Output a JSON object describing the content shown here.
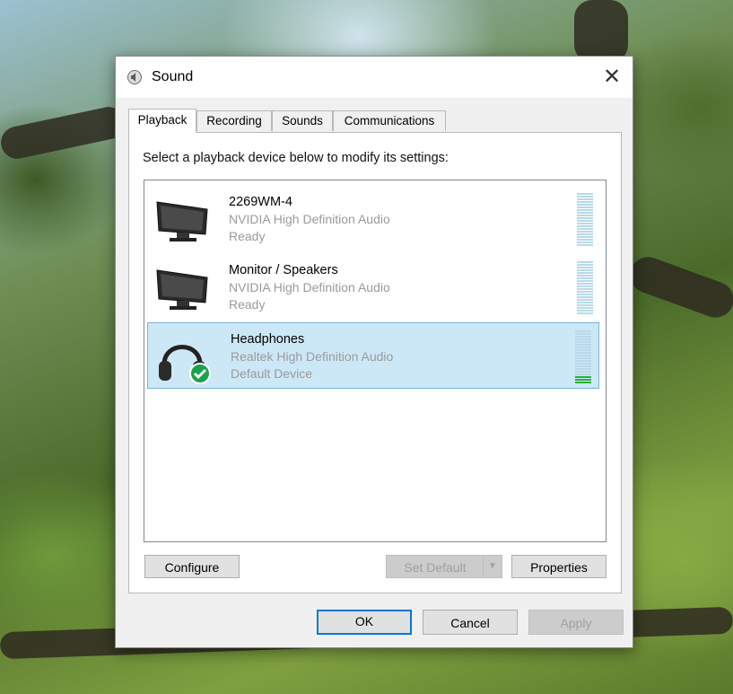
{
  "dialog": {
    "title": "Sound",
    "close_glyph": "✕",
    "tabs": [
      {
        "label": "Playback",
        "active": true
      },
      {
        "label": "Recording",
        "active": false
      },
      {
        "label": "Sounds",
        "active": false
      },
      {
        "label": "Communications",
        "active": false
      }
    ],
    "instruction": "Select a playback device below to modify its settings:",
    "devices": [
      {
        "name": "2269WM-4",
        "description": "NVIDIA High Definition Audio",
        "status": "Ready",
        "icon": "monitor-icon",
        "selected": false,
        "level": 0
      },
      {
        "name": "Monitor / Speakers",
        "description": "NVIDIA High Definition Audio",
        "status": "Ready",
        "icon": "monitor-icon",
        "selected": false,
        "level": 0
      },
      {
        "name": "Headphones",
        "description": "Realtek High Definition Audio",
        "status": "Default Device",
        "icon": "headphones-icon",
        "selected": true,
        "level": 0.15
      }
    ],
    "buttons": {
      "configure": "Configure",
      "set_default": "Set Default",
      "properties": "Properties",
      "ok": "OK",
      "cancel": "Cancel",
      "apply": "Apply"
    },
    "colors": {
      "selection": "#cce8f7",
      "meter_on": "#2db03a",
      "meter_off": "#b7d9e9",
      "default_check": "#1aa34a",
      "focus_border": "#0078d7"
    }
  }
}
